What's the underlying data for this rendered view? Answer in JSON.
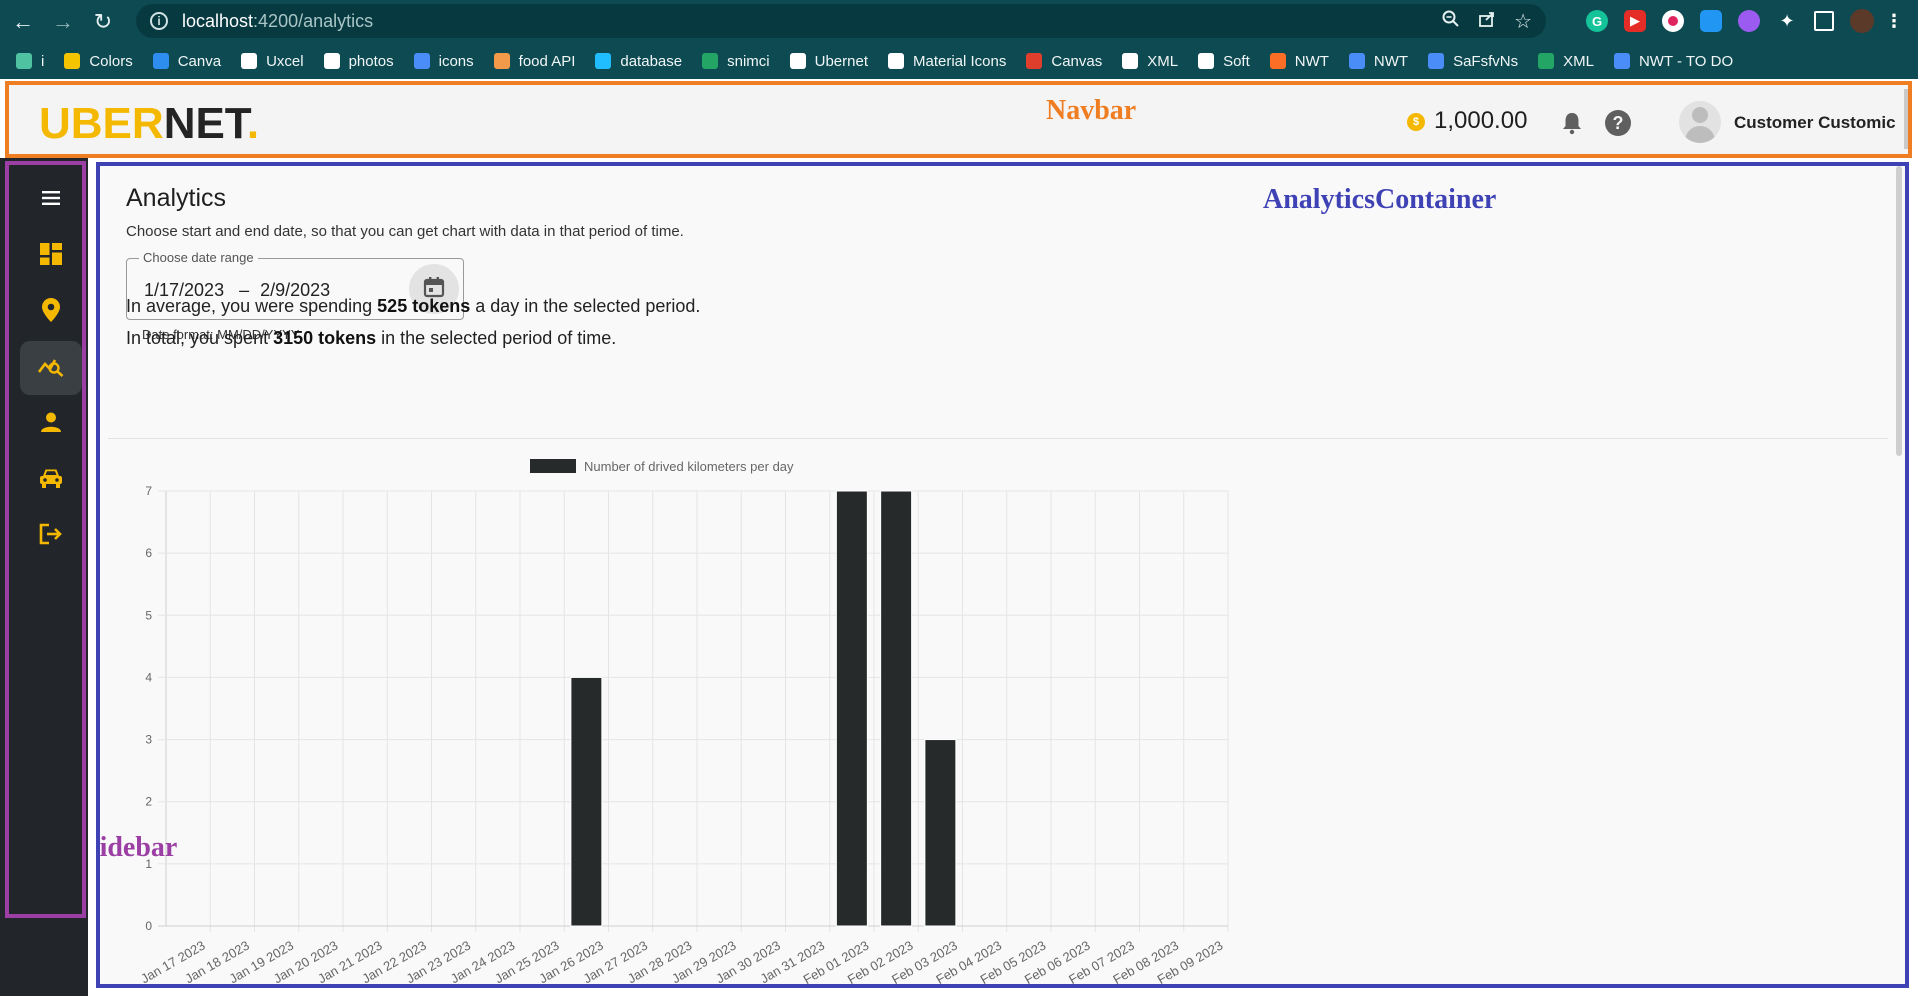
{
  "browser": {
    "url_host": "localhost",
    "url_path": ":4200/analytics",
    "bookmarks": [
      {
        "label": "i",
        "icon": "vuetify-icon",
        "color": "#4fc3a1"
      },
      {
        "label": "Colors",
        "icon": "bee-icon",
        "color": "#f5c400"
      },
      {
        "label": "Canva",
        "icon": "canva-icon",
        "color": "#2e8ef0"
      },
      {
        "label": "Uxcel",
        "icon": "uxcel-icon",
        "color": "#ffffff"
      },
      {
        "label": "photos",
        "icon": "unsplash-icon",
        "color": "#ffffff"
      },
      {
        "label": "icons",
        "icon": "flag-icon",
        "color": "#4a8df8"
      },
      {
        "label": "food API",
        "icon": "burger-icon",
        "color": "#f2994a"
      },
      {
        "label": "database",
        "icon": "kaggle-icon",
        "color": "#20beff"
      },
      {
        "label": "snimci",
        "icon": "plus-icon",
        "color": "#22a565"
      },
      {
        "label": "Ubernet",
        "icon": "github-icon",
        "color": "#ffffff"
      },
      {
        "label": "Material Icons",
        "icon": "globe-icon",
        "color": "#ffffff"
      },
      {
        "label": "Canvas",
        "icon": "canvas-icon",
        "color": "#e03e2d"
      },
      {
        "label": "XML",
        "icon": "github-icon",
        "color": "#ffffff"
      },
      {
        "label": "Soft",
        "icon": "github-icon",
        "color": "#ffffff"
      },
      {
        "label": "NWT",
        "icon": "gitlab-icon",
        "color": "#fc6d26"
      },
      {
        "label": "NWT",
        "icon": "docs-icon",
        "color": "#4a8df8"
      },
      {
        "label": "SaFsfvNs",
        "icon": "image-icon",
        "color": "#4a8df8"
      },
      {
        "label": "XML",
        "icon": "plus-icon",
        "color": "#22a565"
      },
      {
        "label": "NWT - TO DO",
        "icon": "docs-icon",
        "color": "#4a8df8"
      }
    ]
  },
  "navbar": {
    "logo_uber": "UBER",
    "logo_net": "NET",
    "logo_dot": ".",
    "annotation": "Navbar",
    "balance": "1,000.00",
    "coin_symbol": "$",
    "username": "Customer Customic"
  },
  "sidebar": {
    "annotation": "Sidebar",
    "items": [
      {
        "icon": "menu-icon"
      },
      {
        "icon": "dashboard-icon"
      },
      {
        "icon": "location-pin-icon"
      },
      {
        "icon": "analytics-icon",
        "active": true
      },
      {
        "icon": "person-icon"
      },
      {
        "icon": "car-icon"
      },
      {
        "icon": "logout-icon"
      }
    ]
  },
  "analytics": {
    "annotation": "AnalyticsContainer",
    "title": "Analytics",
    "subtitle": "Choose start and end date, so that you can get chart with data in that period of time.",
    "date_range_label": "Choose date range",
    "start_date": "1/17/2023",
    "date_separator": "–",
    "end_date": "2/9/2023",
    "date_format_hint": "Date format: MM/DD/YYYY",
    "avg_prefix": "In average, you were spending ",
    "avg_value": "525 tokens",
    "avg_suffix": " a day in the selected period.",
    "total_prefix": "In total, you spent ",
    "total_value": "3150 tokens",
    "total_suffix": " in the selected period of time."
  },
  "colors": {
    "accent": "#f5b800",
    "navbar_frame": "#ef7d22",
    "container_frame": "#3f42b5",
    "sidebar_frame": "#9b3fa4",
    "bar_fill": "#262a2b"
  },
  "chart_data": {
    "type": "bar",
    "legend": "Number of drived kilometers per day",
    "legend_position": "top",
    "ylim": [
      0,
      7
    ],
    "yticks": [
      0,
      1,
      2,
      3,
      4,
      5,
      6,
      7
    ],
    "grid": true,
    "categories": [
      "Jan 17 2023",
      "Jan 18 2023",
      "Jan 19 2023",
      "Jan 20 2023",
      "Jan 21 2023",
      "Jan 22 2023",
      "Jan 23 2023",
      "Jan 24 2023",
      "Jan 25 2023",
      "Jan 26 2023",
      "Jan 27 2023",
      "Jan 28 2023",
      "Jan 29 2023",
      "Jan 30 2023",
      "Jan 31 2023",
      "Feb 01 2023",
      "Feb 02 2023",
      "Feb 03 2023",
      "Feb 04 2023",
      "Feb 05 2023",
      "Feb 06 2023",
      "Feb 07 2023",
      "Feb 08 2023",
      "Feb 09 2023"
    ],
    "values": [
      0,
      0,
      0,
      0,
      0,
      0,
      0,
      0,
      0,
      4,
      0,
      0,
      0,
      0,
      0,
      7,
      7,
      3,
      0,
      0,
      0,
      0,
      0,
      0
    ]
  }
}
